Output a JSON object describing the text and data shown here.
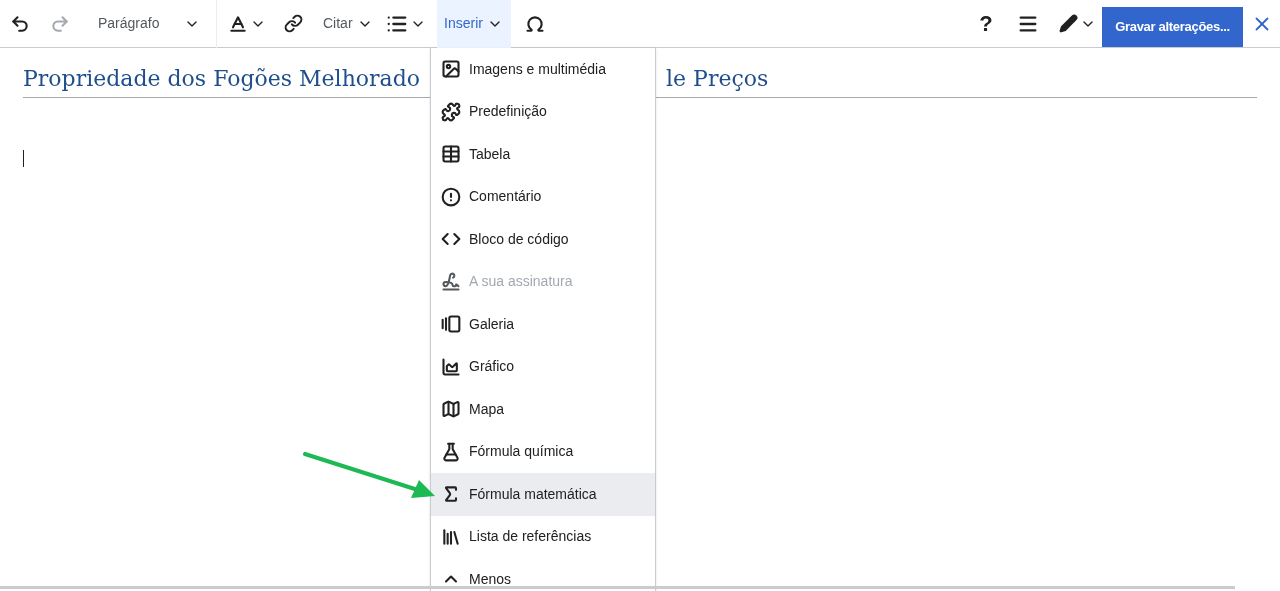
{
  "toolbar": {
    "undo": {
      "disabled": false
    },
    "redo": {
      "disabled": true
    },
    "paragraph": {
      "label": "Parágrafo"
    },
    "cite": {
      "label": "Citar"
    },
    "insert": {
      "label": "Inserir",
      "selected": true
    },
    "help": {
      "label": "?"
    },
    "save_button": {
      "label": "Gravar alterações..."
    }
  },
  "heading": {
    "left": "Propriedade dos Fogões Melhorado",
    "right": "le Preços"
  },
  "insert_menu": {
    "items": [
      {
        "label": "Imagens e multimédia",
        "disabled": false,
        "selected": false
      },
      {
        "label": "Predefinição",
        "disabled": false,
        "selected": false
      },
      {
        "label": "Tabela",
        "disabled": false,
        "selected": false
      },
      {
        "label": "Comentário",
        "disabled": false,
        "selected": false
      },
      {
        "label": "Bloco de código",
        "disabled": false,
        "selected": false
      },
      {
        "label": "A sua assinatura",
        "disabled": true,
        "selected": false
      },
      {
        "label": "Galeria",
        "disabled": false,
        "selected": false
      },
      {
        "label": "Gráfico",
        "disabled": false,
        "selected": false
      },
      {
        "label": "Mapa",
        "disabled": false,
        "selected": false
      },
      {
        "label": "Fórmula química",
        "disabled": false,
        "selected": false
      },
      {
        "label": "Fórmula matemática",
        "disabled": false,
        "selected": true
      },
      {
        "label": "Lista de referências",
        "disabled": false,
        "selected": false
      },
      {
        "label": "Menos",
        "disabled": false,
        "selected": false
      }
    ]
  }
}
